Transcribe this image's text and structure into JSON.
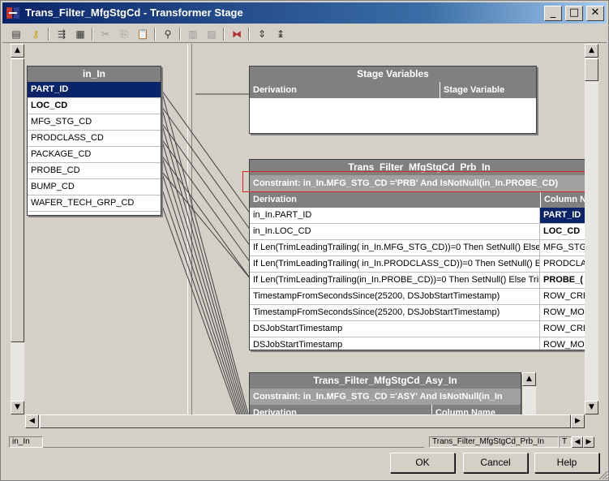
{
  "window": {
    "title": "Trans_Filter_MfgStgCd - Transformer Stage",
    "minimize": "_",
    "maximize": "□",
    "close": "✕"
  },
  "toolbar": {
    "icons": [
      "properties-icon",
      "key-icon",
      "column-auto-match-icon",
      "show-all-icon",
      "cut-icon",
      "copy-icon",
      "paste-icon",
      "find-icon",
      "load-icon",
      "save-icon",
      "output-link-order-icon",
      "input-link-order-icon",
      "ordering-icon"
    ]
  },
  "input_link": {
    "title": "in_In",
    "rows": [
      "PART_ID",
      "LOC_CD",
      "MFG_STG_CD",
      "PRODCLASS_CD",
      "PACKAGE_CD",
      "PROBE_CD",
      "BUMP_CD",
      "WAFER_TECH_GRP_CD"
    ]
  },
  "stage_variables": {
    "title": "Stage Variables",
    "col_derivation": "Derivation",
    "col_variable": "Stage Variable"
  },
  "output_prb": {
    "title": "Trans_Filter_MfgStgCd_Prb_In",
    "constraint": "Constraint: in_In.MFG_STG_CD ='PRB' And IsNotNull(in_In.PROBE_CD)",
    "col_derivation": "Derivation",
    "col_name": "Column N",
    "rows": [
      {
        "derivation": "in_In.PART_ID",
        "column": "PART_ID"
      },
      {
        "derivation": "in_In.LOC_CD",
        "column": "LOC_CD"
      },
      {
        "derivation": "If Len(TrimLeadingTrailing( in_In.MFG_STG_CD))=0 Then SetNull() Else  in",
        "column": "MFG_STG"
      },
      {
        "derivation": "If Len(TrimLeadingTrailing( in_In.PRODCLASS_CD))=0 Then SetNull() Else",
        "column": "PRODCLA"
      },
      {
        "derivation": "If Len(TrimLeadingTrailing(in_In.PROBE_CD))=0 Then SetNull() Else   Trim",
        "column": "PROBE_("
      },
      {
        "derivation": "TimestampFromSecondsSince(25200, DSJobStartTimestamp)",
        "column": "ROW_CRE"
      },
      {
        "derivation": "TimestampFromSecondsSince(25200, DSJobStartTimestamp)",
        "column": "ROW_MO"
      },
      {
        "derivation": "DSJobStartTimestamp",
        "column": "ROW_CRE"
      },
      {
        "derivation": "DSJobStartTimestamp",
        "column": "ROW_MO"
      }
    ]
  },
  "output_asy": {
    "title": "Trans_Filter_MfgStgCd_Asy_In",
    "constraint": "Constraint: in_In.MFG_STG_CD ='ASY' And IsNotNull(in_In",
    "col_derivation": "Derivation",
    "col_name": "Column Name"
  },
  "status_tabs": {
    "left": "in_In",
    "right": "Trans_Filter_MfgStgCd_Prb_In",
    "right2": "T"
  },
  "buttons": {
    "ok": "OK",
    "cancel": "Cancel",
    "help": "Help"
  }
}
